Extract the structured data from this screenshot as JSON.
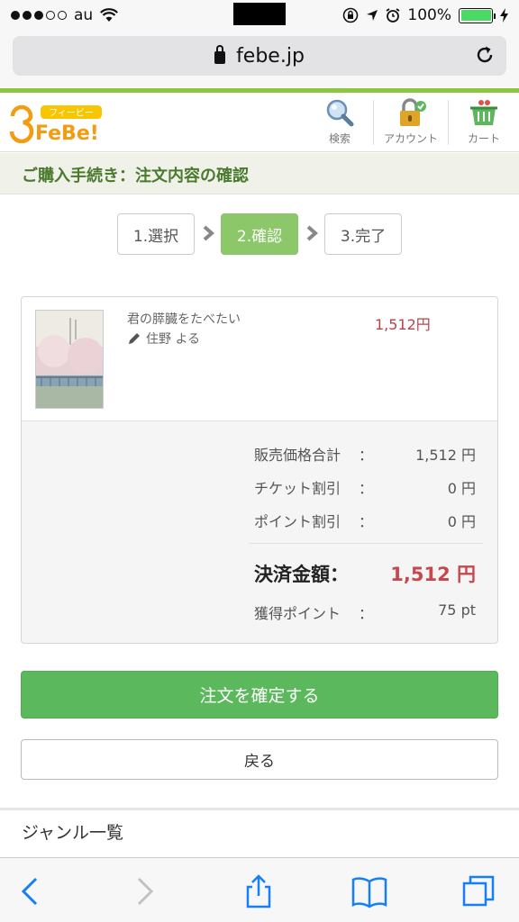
{
  "status_bar": {
    "carrier": "au",
    "battery": "100%",
    "battery_level": 1.0
  },
  "browser": {
    "url": "febe.jp"
  },
  "site": {
    "logo_text": "FeBe!",
    "logo_ruby": "フィービー",
    "nav": [
      {
        "label": "検索",
        "icon": "search-icon"
      },
      {
        "label": "アカウント",
        "icon": "account-lock-icon"
      },
      {
        "label": "カート",
        "icon": "cart-icon"
      }
    ]
  },
  "page": {
    "title": "ご購入手続き：注文内容の確認"
  },
  "steps": [
    {
      "label": "1.選択",
      "active": false
    },
    {
      "label": "2.確認",
      "active": true
    },
    {
      "label": "3.完了",
      "active": false
    }
  ],
  "order": {
    "item": {
      "title": "君の膵臓をたべたい",
      "author": "住野 よる",
      "price": "1,512円"
    },
    "summary": {
      "subtotal_label": "販売価格合計",
      "subtotal_value": "1,512 円",
      "ticket_label": "チケット割引",
      "ticket_value": "0 円",
      "point_label": "ポイント割引",
      "point_value": "0 円",
      "colon": "：",
      "total_label": "決済金額：",
      "total_value": "1,512 円",
      "earned_label": "獲得ポイント",
      "earned_value": "75 pt"
    }
  },
  "actions": {
    "confirm": "注文を確定する",
    "back": "戻る"
  },
  "genre": {
    "title": "ジャンル一覧"
  },
  "colors": {
    "brand_green": "#8cc63f",
    "confirm_green": "#5cb85c",
    "price_red": "#b5434a"
  }
}
